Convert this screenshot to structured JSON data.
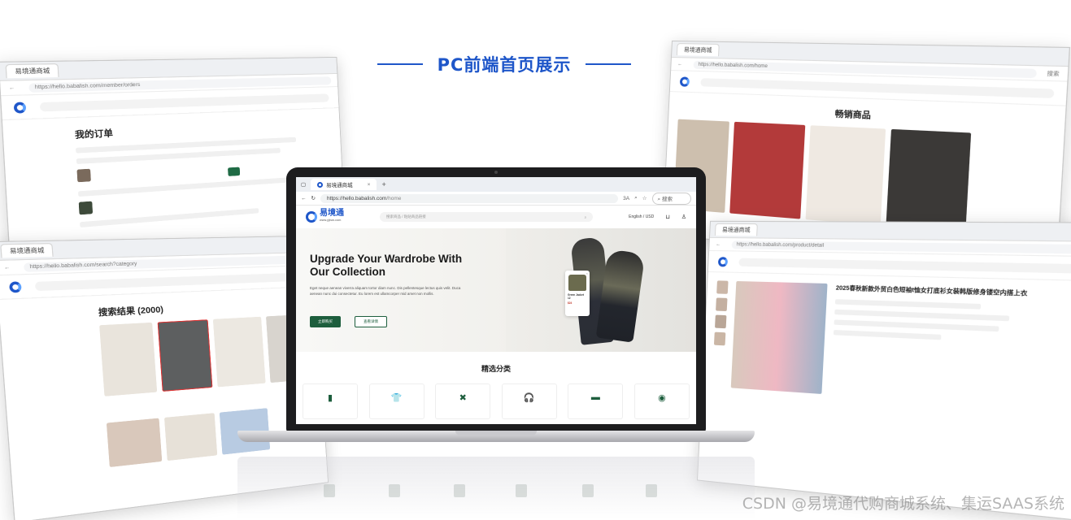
{
  "heading": {
    "title": "PC前端首页展示"
  },
  "laptop": {
    "browser": {
      "tab_title": "易境通商城",
      "tab_close": "×",
      "new_tab": "+",
      "url_host": "https://hello.babalish.com",
      "url_path": "/home",
      "zoom": "3A",
      "search_label": "搜索"
    },
    "site": {
      "logo_text": "易境通",
      "logo_sub": "www.yjtsm.com",
      "search_placeholder": "搜索商品 / 粘贴商品链接",
      "lang_currency": "English / USD",
      "cart_icon": "shopping-bag-icon",
      "user_icon": "user-icon"
    },
    "hero": {
      "title": "Upgrade Your Wardrobe With Our Collection",
      "desc": "Eget neque aenean viverra aliquam tortor diam nunc. Dis pellentesque lectus quis velit. Duca aenean nunc dui consectetur. Eu lorem est ullamcorper mid amet non mollis.",
      "primary_button": "立即购买",
      "secondary_button": "查看详情",
      "product_card": {
        "name": "Green Jacket 12",
        "price": "$24",
        "dismiss": "×"
      }
    },
    "categories_title": "精选分类",
    "categories": [
      {
        "icon": "phone-icon",
        "glyph": "▮"
      },
      {
        "icon": "tshirt-icon",
        "glyph": "👕"
      },
      {
        "icon": "tools-icon",
        "glyph": "✖"
      },
      {
        "icon": "headphones-icon",
        "glyph": "🎧"
      },
      {
        "icon": "book-icon",
        "glyph": "▬"
      },
      {
        "icon": "game-controller-icon",
        "glyph": "◉"
      }
    ]
  },
  "windows": {
    "orders": {
      "tab": "易境通商城",
      "url": "https://hello.babalish.com/member/orders",
      "title": "我的订单"
    },
    "search": {
      "tab": "易境通商城",
      "url": "https://hello.babalish.com/search?category",
      "title": "搜索结果 (2000)"
    },
    "hot": {
      "tab": "易境通商城",
      "url": "https://hello.babalish.com/home",
      "title": "畅销商品",
      "search_label": "搜索"
    },
    "detail": {
      "tab": "易境通商城",
      "url": "https://hello.babalish.com/product/detail",
      "title": "2025春秋新款外贸白色短袖t恤女打底衫女装韩版修身镂空内搭上衣"
    }
  },
  "watermark": "CSDN @易境通代购商城系统、集运SAAS系统"
}
